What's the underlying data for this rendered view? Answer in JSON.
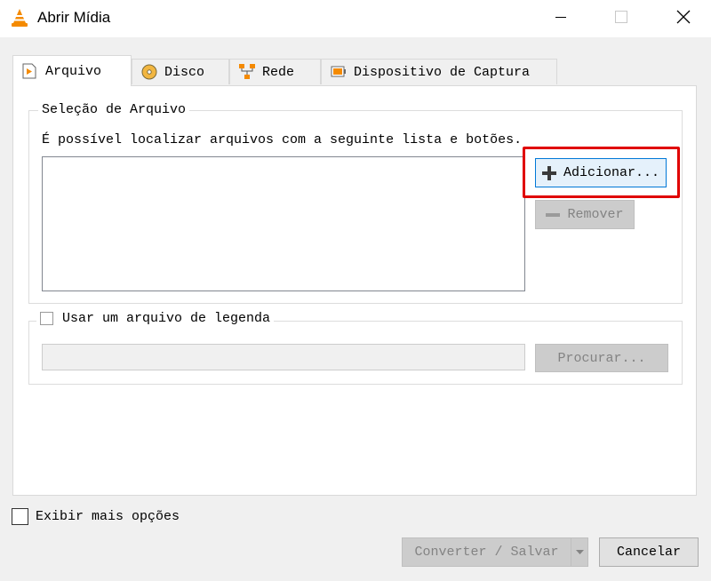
{
  "window": {
    "title": "Abrir Mídia"
  },
  "tabs": [
    {
      "label": "Arquivo",
      "icon": "file-play-icon",
      "active": true
    },
    {
      "label": "Disco",
      "icon": "disc-icon",
      "active": false
    },
    {
      "label": "Rede",
      "icon": "network-icon",
      "active": false
    },
    {
      "label": "Dispositivo de Captura",
      "icon": "capture-device-icon",
      "active": false
    }
  ],
  "file_selection": {
    "group_title": "Seleção de Arquivo",
    "description": "É possível localizar arquivos com a seguinte lista e botões.",
    "files": [],
    "add_label": "Adicionar...",
    "remove_label": "Remover"
  },
  "subtitle": {
    "checkbox_label": "Usar um arquivo de legenda",
    "checked": false,
    "path_value": "",
    "browse_label": "Procurar..."
  },
  "footer": {
    "more_options_label": "Exibir mais opções",
    "more_options_checked": false,
    "convert_label": "Converter / Salvar",
    "cancel_label": "Cancelar"
  },
  "colors": {
    "highlight": "#e00000",
    "focus_border": "#0078d7",
    "vlc_orange": "#f48a00"
  }
}
